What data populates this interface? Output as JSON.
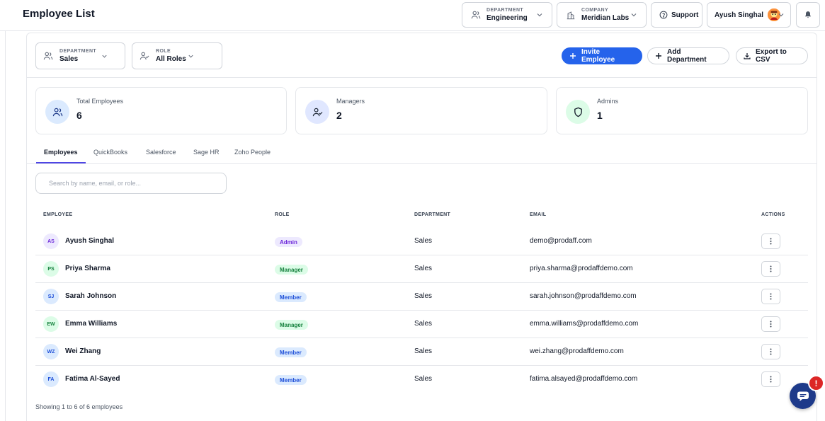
{
  "header": {
    "title": "Employee List",
    "department": {
      "label": "DEPARTMENT",
      "value": "Engineering"
    },
    "company": {
      "label": "COMPANY",
      "value": "Meridian Labs"
    },
    "support_label": "Support",
    "user": {
      "name": "Ayush Singhal"
    }
  },
  "filters": {
    "department": {
      "label": "DEPARTMENT",
      "value": "Sales"
    },
    "role": {
      "label": "ROLE",
      "value": "All Roles"
    }
  },
  "actions": {
    "invite_label": "Invite Employee",
    "add_department_label": "Add Department",
    "export_label": "Export to CSV"
  },
  "stats": [
    {
      "label": "Total Employees",
      "value": "6"
    },
    {
      "label": "Managers",
      "value": "2"
    },
    {
      "label": "Admins",
      "value": "1"
    }
  ],
  "tabs": [
    "Employees",
    "QuickBooks",
    "Salesforce",
    "Sage HR",
    "Zoho People"
  ],
  "search": {
    "placeholder": "Search by name, email, or role..."
  },
  "table": {
    "columns": [
      "EMPLOYEE",
      "ROLE",
      "DEPARTMENT",
      "EMAIL",
      "ACTIONS"
    ],
    "rows": [
      {
        "initials": "AS",
        "name": "Ayush Singhal",
        "role": "Admin",
        "department": "Sales",
        "email": "demo@prodaff.com"
      },
      {
        "initials": "PS",
        "name": "Priya Sharma",
        "role": "Manager",
        "department": "Sales",
        "email": "priya.sharma@prodaffdemo.com"
      },
      {
        "initials": "SJ",
        "name": "Sarah Johnson",
        "role": "Member",
        "department": "Sales",
        "email": "sarah.johnson@prodaffdemo.com"
      },
      {
        "initials": "EW",
        "name": "Emma Williams",
        "role": "Manager",
        "department": "Sales",
        "email": "emma.williams@prodaffdemo.com"
      },
      {
        "initials": "WZ",
        "name": "Wei Zhang",
        "role": "Member",
        "department": "Sales",
        "email": "wei.zhang@prodaffdemo.com"
      },
      {
        "initials": "FA",
        "name": "Fatima Al-Sayed",
        "role": "Member",
        "department": "Sales",
        "email": "fatima.alsayed@prodaffdemo.com"
      }
    ]
  },
  "footer": {
    "text": "Showing 1 to 6 of 6 employees"
  },
  "chat": {
    "badge": "!"
  },
  "colors": {
    "primary": "#2563eb",
    "admin_badge": "#6d28d9",
    "manager_badge": "#15803d",
    "member_badge": "#1d4ed8",
    "chat_button": "#1e3a8a",
    "chat_badge": "#dc2626"
  },
  "icons": {
    "department": "users-icon",
    "company": "building-icon",
    "support": "help-circle-icon",
    "notifications": "bell-icon",
    "role": "user-check-icon",
    "invite": "plus-icon",
    "add_department": "plus-icon",
    "export": "download-icon",
    "stat_total": "users-icon",
    "stat_managers": "user-check-icon",
    "stat_admins": "shield-icon",
    "row_actions": "more-vertical-icon",
    "chat": "chat-icon"
  }
}
